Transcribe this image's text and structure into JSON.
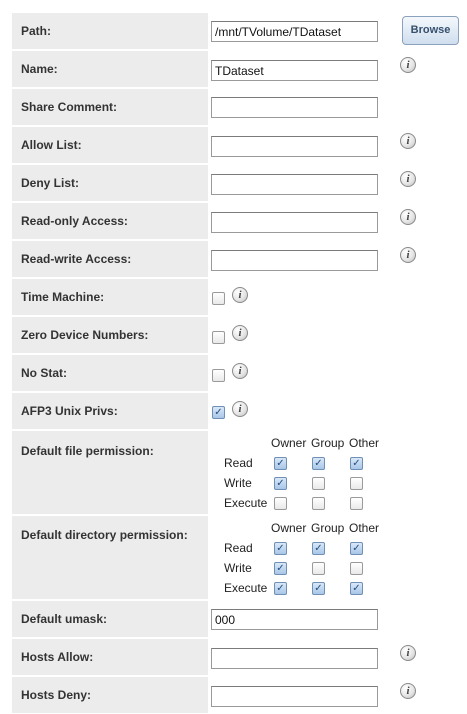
{
  "form": {
    "path": {
      "label": "Path:",
      "value": "/mnt/TVolume/TDataset"
    },
    "browse_label": "Browse",
    "name": {
      "label": "Name:",
      "value": "TDataset"
    },
    "share_comment": {
      "label": "Share Comment:",
      "value": ""
    },
    "allow_list": {
      "label": "Allow List:",
      "value": ""
    },
    "deny_list": {
      "label": "Deny List:",
      "value": ""
    },
    "read_only_access": {
      "label": "Read-only Access:",
      "value": ""
    },
    "read_write_access": {
      "label": "Read-write Access:",
      "value": ""
    },
    "time_machine": {
      "label": "Time Machine:",
      "checked": false
    },
    "zero_device_numbers": {
      "label": "Zero Device Numbers:",
      "checked": false
    },
    "no_stat": {
      "label": "No Stat:",
      "checked": false
    },
    "afp3_unix_privs": {
      "label": "AFP3 Unix Privs:",
      "checked": true
    },
    "default_file_permission": {
      "label": "Default file permission:",
      "columns": [
        "Owner",
        "Group",
        "Other"
      ],
      "rows": [
        {
          "label": "Read",
          "values": [
            true,
            true,
            true
          ]
        },
        {
          "label": "Write",
          "values": [
            true,
            false,
            false
          ]
        },
        {
          "label": "Execute",
          "values": [
            false,
            false,
            false
          ]
        }
      ]
    },
    "default_directory_permission": {
      "label": "Default directory permission:",
      "columns": [
        "Owner",
        "Group",
        "Other"
      ],
      "rows": [
        {
          "label": "Read",
          "values": [
            true,
            true,
            true
          ]
        },
        {
          "label": "Write",
          "values": [
            true,
            false,
            false
          ]
        },
        {
          "label": "Execute",
          "values": [
            true,
            true,
            true
          ]
        }
      ]
    },
    "default_umask": {
      "label": "Default umask:",
      "value": "000"
    },
    "hosts_allow": {
      "label": "Hosts Allow:",
      "value": ""
    },
    "hosts_deny": {
      "label": "Hosts Deny:",
      "value": ""
    }
  },
  "icons": {
    "info": "info-icon",
    "check": "checkmark-icon"
  },
  "info_glyph": "i"
}
